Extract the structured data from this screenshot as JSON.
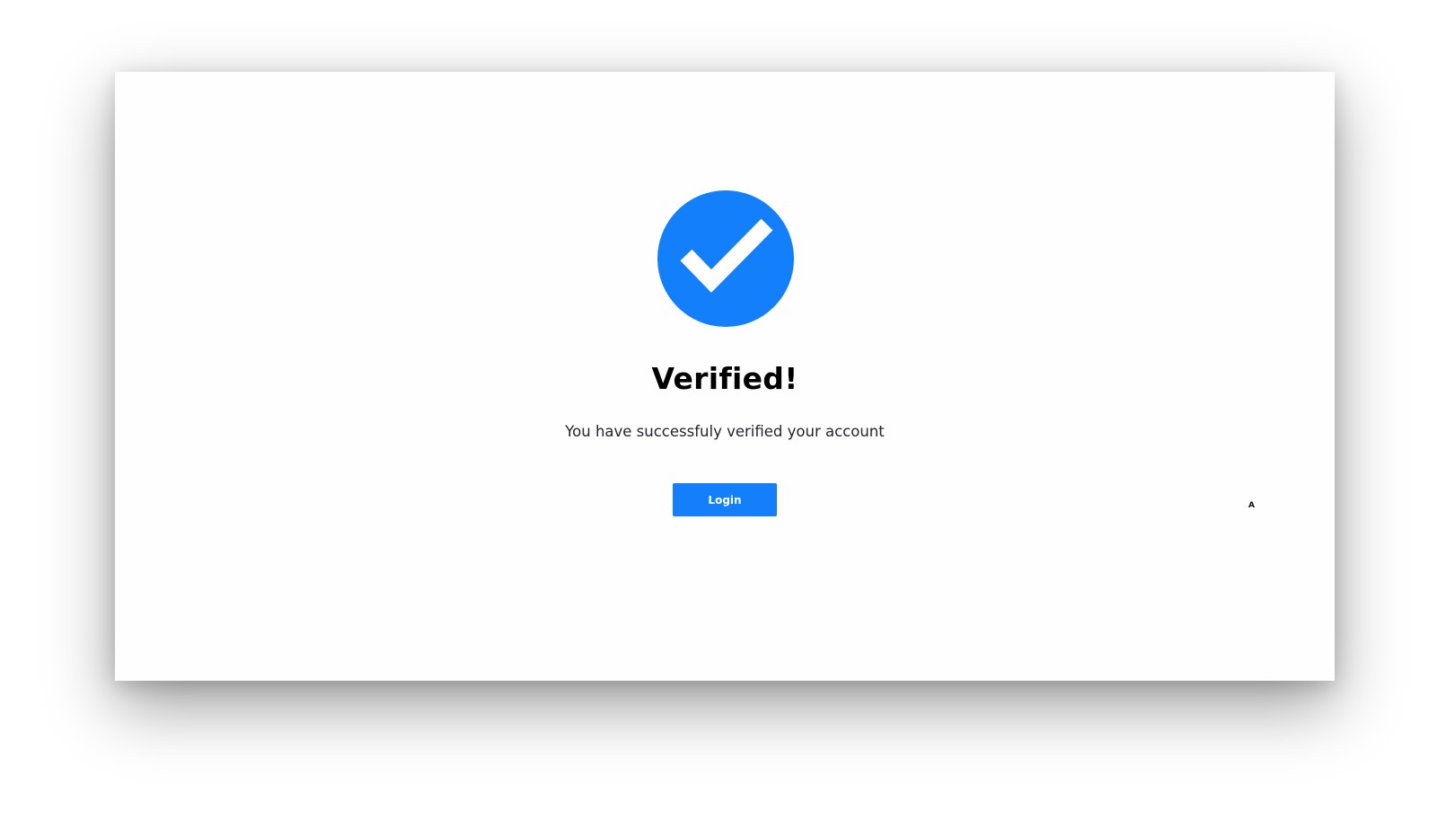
{
  "verification": {
    "title": "Verified!",
    "message": "You have successfuly verified your account",
    "login_label": "Login",
    "corner_mark": "A"
  },
  "icons": {
    "badge": "check-circle-icon"
  },
  "colors": {
    "accent": "#137ffb",
    "title": "#000000",
    "message": "#22252b",
    "page_background": "#ffffff",
    "card_background": "#fefefe"
  }
}
